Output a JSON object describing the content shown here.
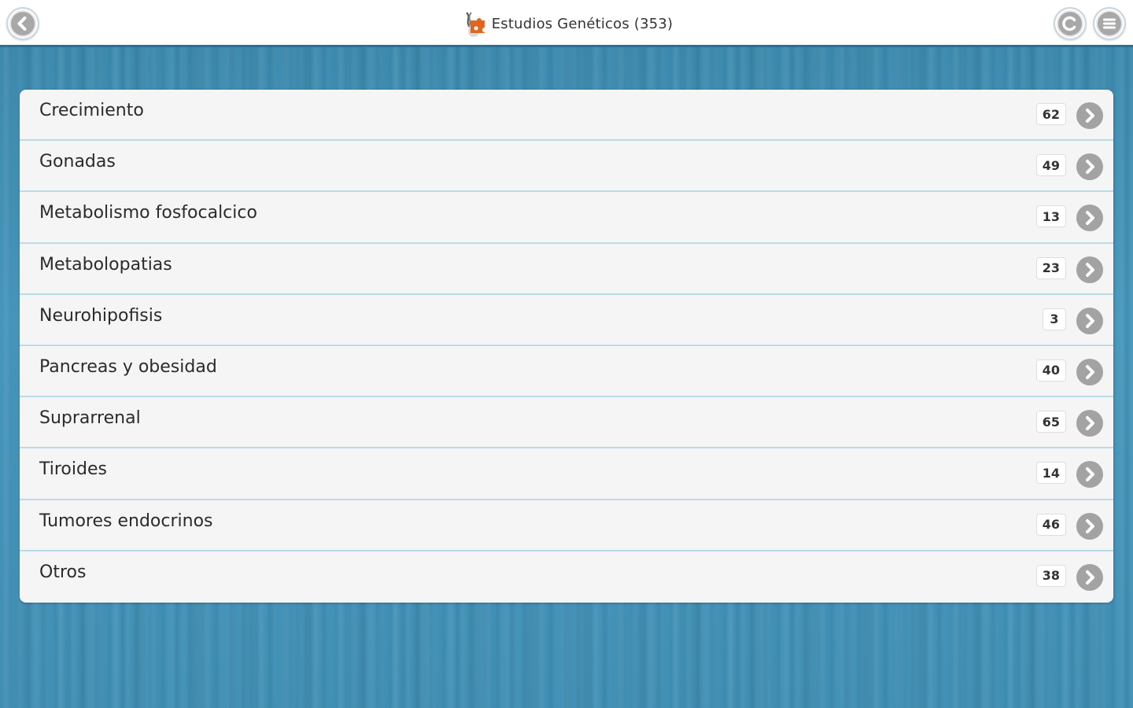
{
  "header": {
    "title": "Estudios Genéticos (353)",
    "title_icon": "dna-puzzle-icon",
    "back_icon": "back-arrow-icon",
    "refresh_icon": "copyright-refresh-icon",
    "menu_icon": "hamburger-menu-icon"
  },
  "list": {
    "items": [
      {
        "label": "Crecimiento",
        "count": "62"
      },
      {
        "label": "Gonadas",
        "count": "49"
      },
      {
        "label": "Metabolismo fosfocalcico",
        "count": "13"
      },
      {
        "label": "Metabolopatias",
        "count": "23"
      },
      {
        "label": "Neurohipofisis",
        "count": "3"
      },
      {
        "label": "Pancreas y obesidad",
        "count": "40"
      },
      {
        "label": "Suprarrenal",
        "count": "65"
      },
      {
        "label": "Tiroides",
        "count": "14"
      },
      {
        "label": "Tumores endocrinos",
        "count": "46"
      },
      {
        "label": "Otros",
        "count": "38"
      }
    ]
  },
  "colors": {
    "background": "#3f8fb5",
    "header_border": "#2c6f93",
    "row_divider": "#b9dbe7",
    "accent": "#e0661f"
  }
}
